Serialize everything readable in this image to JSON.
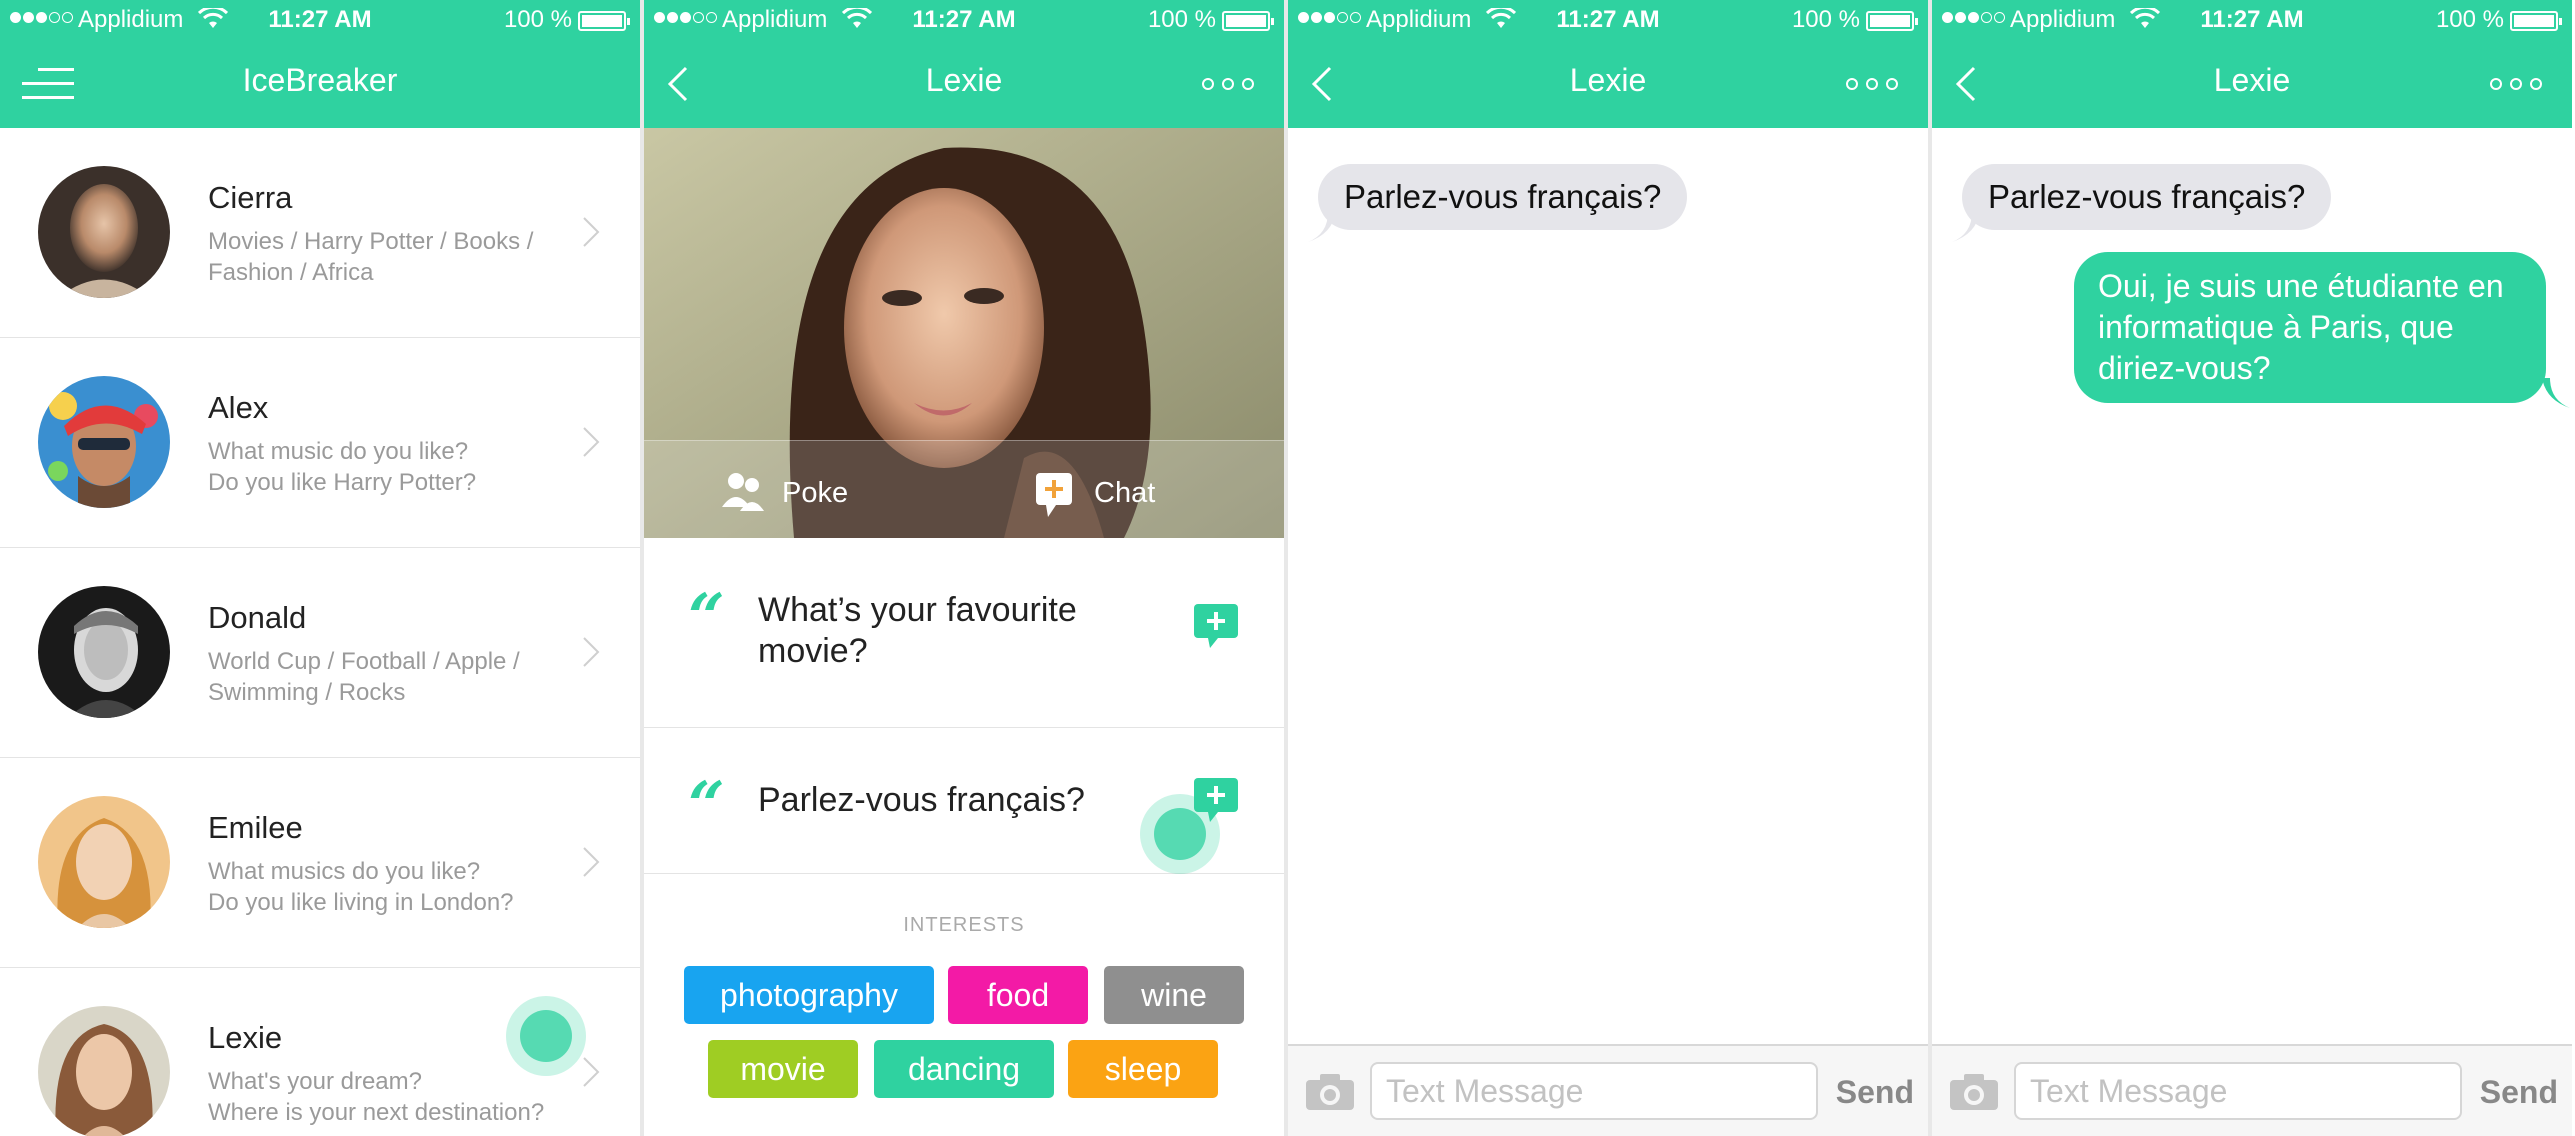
{
  "status_bar": {
    "carrier": "Applidium",
    "time": "11:27 AM",
    "battery": "100 %"
  },
  "colors": {
    "accent": "#2fd2a0"
  },
  "screen_list": {
    "title": "IceBreaker",
    "contacts": [
      {
        "name": "Cierra",
        "line1": "Movies / Harry Potter / Books /",
        "line2": "Fashion / Africa"
      },
      {
        "name": "Alex",
        "line1": "What music do you like?",
        "line2": "Do you like Harry Potter?"
      },
      {
        "name": "Donald",
        "line1": "World Cup / Football / Apple /",
        "line2": "Swimming / Rocks"
      },
      {
        "name": "Emilee",
        "line1": "What musics do you like?",
        "line2": "Do you like living in London?"
      },
      {
        "name": "Lexie",
        "line1": "What's your dream?",
        "line2": "Where is your next destination?"
      }
    ]
  },
  "screen_profile": {
    "title": "Lexie",
    "poke_label": "Poke",
    "chat_label": "Chat",
    "quote_glyph": "“",
    "questions": [
      "What’s your favourite movie?",
      "Parlez-vous français?"
    ],
    "interests_heading": "INTERESTS",
    "interests": [
      {
        "label": "photography",
        "color": "#18a4f0"
      },
      {
        "label": "food",
        "color": "#f31aa6"
      },
      {
        "label": "wine",
        "color": "#8f8f8f"
      },
      {
        "label": "movie",
        "color": "#9fcd23"
      },
      {
        "label": "dancing",
        "color": "#2fd2a0"
      },
      {
        "label": "sleep",
        "color": "#fba313"
      }
    ]
  },
  "screen_chat_1": {
    "title": "Lexie",
    "incoming": "Parlez-vous français?",
    "input_placeholder": "Text Message",
    "send_label": "Send"
  },
  "screen_chat_2": {
    "title": "Lexie",
    "incoming": "Parlez-vous français?",
    "outgoing": "Oui, je suis une étudiante en informatique à Paris, que diriez-vous?",
    "input_placeholder": "Text Message",
    "send_label": "Send"
  }
}
